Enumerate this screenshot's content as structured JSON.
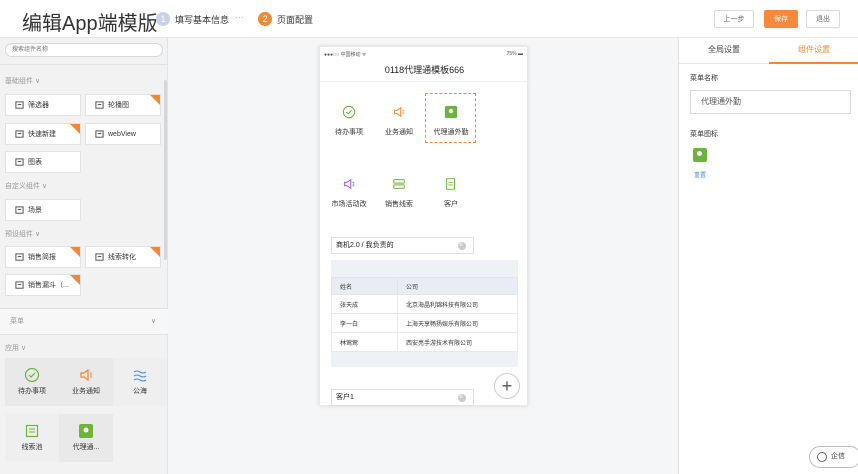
{
  "header": {
    "title": "编辑App端模版",
    "steps": [
      {
        "num": "1",
        "label": "填写基本信息"
      },
      {
        "num": "2",
        "label": "页面配置"
      }
    ],
    "dots": "···",
    "buttons": {
      "prev": "上一步",
      "save": "保存",
      "exit": "退出"
    }
  },
  "sidebar": {
    "search_placeholder": "搜索组件名称",
    "basic_section": "基础组件 ∨",
    "basic": [
      "筛选器",
      "轮播图",
      "快速新建",
      "webView",
      "图表"
    ],
    "custom_section": "自定义组件 ∨",
    "custom": [
      "场景"
    ],
    "preset_section": "预设组件 ∨",
    "preset": [
      "销售简报",
      "线索转化",
      "销售漏斗（..."
    ],
    "menu_label": "菜单",
    "app_section": "应用 ∨",
    "apps": [
      "待办事项",
      "业务通知",
      "公海",
      "线索池",
      "代理通..."
    ]
  },
  "phone": {
    "carrier": "●●●○○ 中国移动 ᯤ",
    "battery": "75% ▬",
    "title": "0118代理通模板666",
    "items_row1": [
      "待办事项",
      "业务通知",
      "代理通外勤"
    ],
    "items_row2": [
      "市场活动改",
      "销售线索",
      "客户"
    ],
    "filter1": "商机2.0 / 我负责的",
    "table_headers": [
      "姓名",
      "公司"
    ],
    "table_rows": [
      [
        "张天成",
        "北京海晶利锦科技有限公司"
      ],
      [
        "李一白",
        "上海天享畅扬娱乐有限公司"
      ],
      [
        "林莺莺",
        "西安亮手游技术有限公司"
      ]
    ],
    "filter2": "客户1",
    "fab": "+"
  },
  "right": {
    "tabs": [
      "全局设置",
      "组件设置"
    ],
    "menu_name_label": "菜单名称",
    "menu_name_value": "代理通外勤",
    "menu_icon_label": "菜单图标",
    "reset": "重置"
  },
  "chat": {
    "label": "企信"
  },
  "colors": {
    "accent": "#f08a31",
    "green": "#6db33f",
    "purple": "#9b59d0",
    "blue": "#4a90e2"
  }
}
